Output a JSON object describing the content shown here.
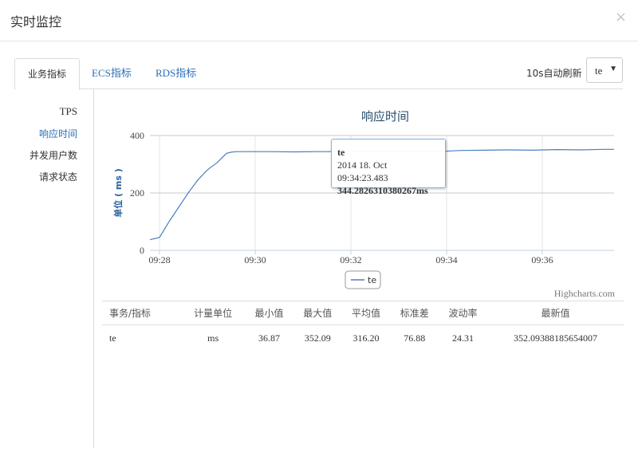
{
  "modal": {
    "title": "实时监控",
    "close_glyph": "×"
  },
  "tabs": [
    {
      "label": "业务指标",
      "active": true
    },
    {
      "label": "ECS指标",
      "active": false
    },
    {
      "label": "RDS指标",
      "active": false
    }
  ],
  "refresh": {
    "label": "10s自动刷新",
    "selected": "te"
  },
  "sidenav": {
    "items": [
      {
        "label": "TPS",
        "active": false
      },
      {
        "label": "响应时间",
        "active": true
      },
      {
        "label": "并发用户数",
        "active": false
      },
      {
        "label": "请求状态",
        "active": false
      }
    ]
  },
  "chart_data": {
    "type": "line",
    "title": "响应时间",
    "ylabel": "单位 ( ms )",
    "xlabel": "",
    "ylim": [
      0,
      400
    ],
    "yticks": [
      "0",
      "200",
      "400"
    ],
    "xticks": [
      "09:28",
      "09:30",
      "09:32",
      "09:34",
      "09:36"
    ],
    "xlim_minutes": [
      0,
      9.7
    ],
    "grid": true,
    "legend_position": "bottom-center",
    "credit": "Highcharts.com",
    "series": [
      {
        "name": "te",
        "color": "#4a7fc1",
        "x_minutes": [
          0.0,
          0.2,
          0.4,
          0.6,
          0.8,
          1.0,
          1.2,
          1.4,
          1.6,
          1.7,
          1.8,
          2.0,
          2.5,
          3.0,
          3.5,
          4.0,
          4.5,
          5.0,
          5.5,
          6.0,
          6.5,
          7.0,
          7.5,
          8.0,
          8.5,
          9.0,
          9.5,
          9.7
        ],
        "values": [
          37,
          45,
          100,
          150,
          200,
          245,
          280,
          305,
          338,
          342,
          344,
          344,
          344,
          343,
          344,
          344,
          345,
          345,
          345,
          344,
          348,
          349,
          350,
          349,
          351,
          350,
          352,
          352
        ]
      }
    ],
    "tooltip": {
      "series": "te",
      "time": "2014 18. Oct 09:34:23.483",
      "value": "344.2826310380267ms"
    }
  },
  "stats_table": {
    "headers": [
      "事务/指标",
      "计量单位",
      "最小值",
      "最大值",
      "平均值",
      "标准差",
      "波动率",
      "最新值"
    ],
    "rows": [
      [
        "te",
        "ms",
        "36.87",
        "352.09",
        "316.20",
        "76.88",
        "24.31",
        "352.09388185654007"
      ]
    ]
  }
}
